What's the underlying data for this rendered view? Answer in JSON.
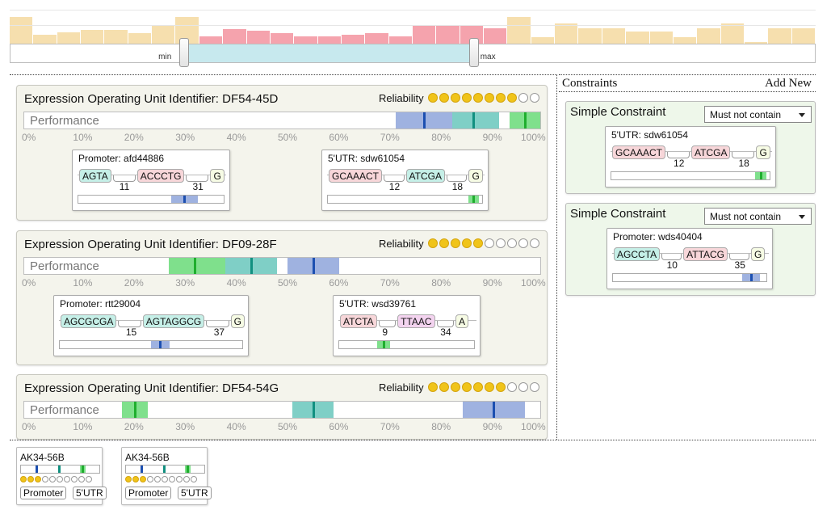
{
  "histogram": {
    "bars": [
      {
        "value": 0.78,
        "selected": false
      },
      {
        "value": 0.27,
        "selected": false
      },
      {
        "value": 0.33,
        "selected": false
      },
      {
        "value": 0.4,
        "selected": false
      },
      {
        "value": 0.4,
        "selected": false
      },
      {
        "value": 0.3,
        "selected": false
      },
      {
        "value": 0.52,
        "selected": false
      },
      {
        "value": 0.78,
        "selected": false
      },
      {
        "value": 0.22,
        "selected": true
      },
      {
        "value": 0.42,
        "selected": true
      },
      {
        "value": 0.37,
        "selected": true
      },
      {
        "value": 0.3,
        "selected": true
      },
      {
        "value": 0.22,
        "selected": true
      },
      {
        "value": 0.22,
        "selected": true
      },
      {
        "value": 0.26,
        "selected": true
      },
      {
        "value": 0.32,
        "selected": true
      },
      {
        "value": 0.22,
        "selected": true
      },
      {
        "value": 0.52,
        "selected": true
      },
      {
        "value": 0.52,
        "selected": true
      },
      {
        "value": 0.52,
        "selected": true
      },
      {
        "value": 0.45,
        "selected": true
      },
      {
        "value": 0.78,
        "selected": false
      },
      {
        "value": 0.2,
        "selected": false
      },
      {
        "value": 0.6,
        "selected": false
      },
      {
        "value": 0.45,
        "selected": false
      },
      {
        "value": 0.45,
        "selected": false
      },
      {
        "value": 0.36,
        "selected": false
      },
      {
        "value": 0.36,
        "selected": false
      },
      {
        "value": 0.2,
        "selected": false
      },
      {
        "value": 0.45,
        "selected": false
      },
      {
        "value": 0.6,
        "selected": false
      },
      {
        "value": 0.05,
        "selected": false
      },
      {
        "value": 0.45,
        "selected": false
      },
      {
        "value": 0.45,
        "selected": false
      }
    ],
    "range_min_label": "min",
    "range_max_label": "max",
    "range": {
      "min": 0.21,
      "max": 0.57
    }
  },
  "colors": {
    "hist_selected": "#f5a3ad",
    "hist_unselected": "#f6dfae",
    "green": "#7fe08c",
    "green_tick": "#1fae2e",
    "teal": "#7fcfc6",
    "teal_tick": "#119080",
    "blue": "#9fb2e0",
    "blue_tick": "#1c4fb0"
  },
  "axis_ticks": [
    "0%",
    "10%",
    "20%",
    "30%",
    "40%",
    "50%",
    "60%",
    "70%",
    "80%",
    "90%",
    "100%"
  ],
  "eous": [
    {
      "title": "Expression Operating Unit Identifier: DF54-45D",
      "reliability_label": "Reliability",
      "reliability": 8,
      "reliability_max": 10,
      "performance_label": "Performance",
      "bands": [
        {
          "color": "blue",
          "from": 0.72,
          "to": 0.83,
          "tick": 0.775
        },
        {
          "color": "teal",
          "from": 0.83,
          "to": 0.92,
          "tick": 0.87
        },
        {
          "color": "green",
          "from": 0.94,
          "to": 1.0,
          "tick": 0.97
        }
      ],
      "parts": [
        {
          "title": "Promoter: afd44886",
          "tokens": [
            {
              "text": "AGTA",
              "color": "#c5efe7"
            },
            {
              "text": "ACCCTG",
              "color": "#f7d6d9"
            },
            {
              "text": "G",
              "color": "#f6fbe4"
            }
          ],
          "gaps": [
            "11",
            "31"
          ],
          "bar": {
            "color": "blue",
            "from": 0.64,
            "to": 0.82,
            "tick": 0.73
          }
        },
        {
          "title": "5'UTR: sdw61054",
          "tokens": [
            {
              "text": "GCAAACT",
              "color": "#f7d6d9"
            },
            {
              "text": "ATCGA",
              "color": "#c5efe7"
            },
            {
              "text": "G",
              "color": "#f6fbe4"
            }
          ],
          "gaps": [
            "12",
            "18"
          ],
          "bar": {
            "color": "green",
            "from": 0.91,
            "to": 0.98,
            "tick": 0.945
          }
        }
      ]
    },
    {
      "title": "Expression Operating Unit Identifier: DF09-28F",
      "reliability_label": "Reliability",
      "reliability": 5,
      "reliability_max": 10,
      "performance_label": "Performance",
      "bands": [
        {
          "color": "green",
          "from": 0.28,
          "to": 0.39,
          "tick": 0.33
        },
        {
          "color": "teal",
          "from": 0.39,
          "to": 0.49,
          "tick": 0.44
        },
        {
          "color": "blue",
          "from": 0.51,
          "to": 0.61,
          "tick": 0.56
        }
      ],
      "parts": [
        {
          "title": "Promoter: rtt29004",
          "tokens": [
            {
              "text": "AGCGCGA",
              "color": "#c5efe7"
            },
            {
              "text": "AGTAGGCG",
              "color": "#c5efe7"
            },
            {
              "text": "G",
              "color": "#f6fbe4"
            }
          ],
          "gaps": [
            "15",
            "37"
          ],
          "bar": {
            "color": "blue",
            "from": 0.5,
            "to": 0.6,
            "tick": 0.55
          }
        },
        {
          "title": "5'UTR: wsd39761",
          "tokens": [
            {
              "text": "ATCTA",
              "color": "#f7d6d9"
            },
            {
              "text": "TTAAC",
              "color": "#f3d3ef"
            },
            {
              "text": "A",
              "color": "#f6fbe4"
            }
          ],
          "gaps": [
            "9",
            "34"
          ],
          "bar": {
            "color": "green",
            "from": 0.28,
            "to": 0.38,
            "tick": 0.33
          }
        }
      ]
    },
    {
      "title": "Expression Operating Unit Identifier: DF54-54G",
      "reliability_label": "Reliability",
      "reliability": 7,
      "reliability_max": 10,
      "performance_label": "Performance",
      "bands": [
        {
          "color": "green",
          "from": 0.19,
          "to": 0.24,
          "tick": 0.215
        },
        {
          "color": "teal",
          "from": 0.52,
          "to": 0.6,
          "tick": 0.56
        },
        {
          "color": "blue",
          "from": 0.85,
          "to": 0.97,
          "tick": 0.91
        }
      ],
      "parts": []
    }
  ],
  "constraints": {
    "title": "Constraints",
    "add_new": "Add New",
    "items": [
      {
        "title": "Simple Constraint",
        "select_value": "Must not contain",
        "part": {
          "title": "5'UTR: sdw61054",
          "tokens": [
            {
              "text": "GCAAACT",
              "color": "#f7d6d9"
            },
            {
              "text": "ATCGA",
              "color": "#f7d6d9"
            },
            {
              "text": "G",
              "color": "#f6fbe4"
            }
          ],
          "gaps": [
            "12",
            "18"
          ],
          "bar": {
            "color": "green",
            "from": 0.91,
            "to": 0.98,
            "tick": 0.945
          }
        }
      },
      {
        "title": "Simple Constraint",
        "select_value": "Must not contain",
        "part": {
          "title": "Promoter: wds40404",
          "tokens": [
            {
              "text": "AGCCTA",
              "color": "#c5efe7"
            },
            {
              "text": "ATTACG",
              "color": "#f7d6d9"
            },
            {
              "text": "G",
              "color": "#f6fbe4"
            }
          ],
          "gaps": [
            "10",
            "35"
          ],
          "bar": {
            "color": "blue",
            "from": 0.84,
            "to": 0.96,
            "tick": 0.9
          }
        }
      }
    ]
  },
  "cards": [
    {
      "title": "AK34-56B",
      "reliability": 3,
      "reliability_max": 10,
      "bands": [
        {
          "color": "blue",
          "tick": 0.2
        },
        {
          "color": "teal",
          "tick": 0.48
        },
        {
          "color": "green",
          "from": 0.75,
          "to": 0.82,
          "tick": 0.78
        }
      ],
      "tags": [
        "Promoter",
        "5'UTR"
      ]
    },
    {
      "title": "AK34-56B",
      "reliability": 3,
      "reliability_max": 10,
      "bands": [
        {
          "color": "blue",
          "tick": 0.2
        },
        {
          "color": "teal",
          "tick": 0.48
        },
        {
          "color": "green",
          "from": 0.75,
          "to": 0.82,
          "tick": 0.78
        }
      ],
      "tags": [
        "Promoter",
        "5'UTR"
      ]
    }
  ]
}
